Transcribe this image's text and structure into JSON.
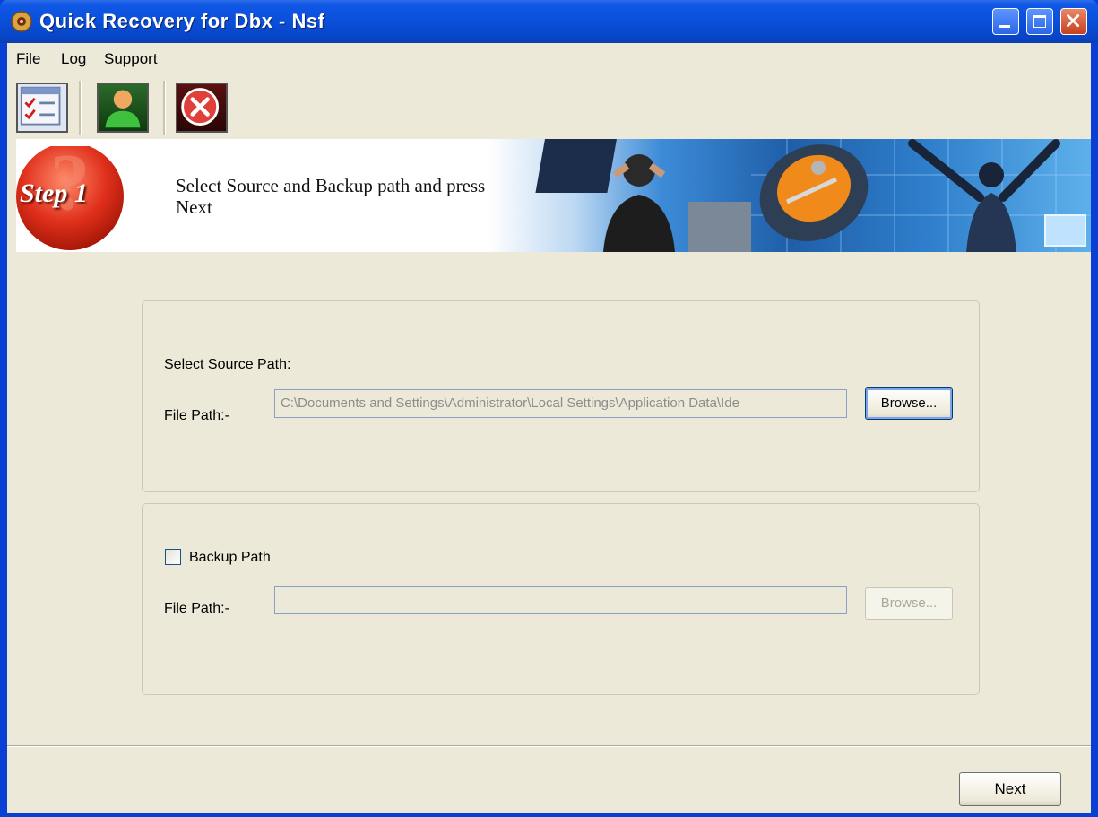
{
  "window": {
    "title": "Quick Recovery for Dbx - Nsf"
  },
  "menu": {
    "items": [
      "File",
      "Log",
      "Support"
    ]
  },
  "toolbar": {
    "icons": [
      "checklist-icon",
      "user-icon",
      "exit-icon"
    ]
  },
  "banner": {
    "step_label": "Step 1",
    "instruction": "Select Source and Backup path and press Next"
  },
  "source": {
    "heading": "Select Source Path:",
    "file_path_label": "File Path:-",
    "path_value": "C:\\Documents and Settings\\Administrator\\Local Settings\\Application Data\\Ide",
    "browse_label": "Browse..."
  },
  "backup": {
    "checkbox_label": "Backup Path",
    "checked": false,
    "file_path_label": "File Path:-",
    "path_value": "",
    "browse_label": "Browse..."
  },
  "footer": {
    "next_label": "Next"
  },
  "colors": {
    "titlebar": "#0a4fd9",
    "window_bg": "#ece9d8",
    "close": "#c8401e"
  }
}
